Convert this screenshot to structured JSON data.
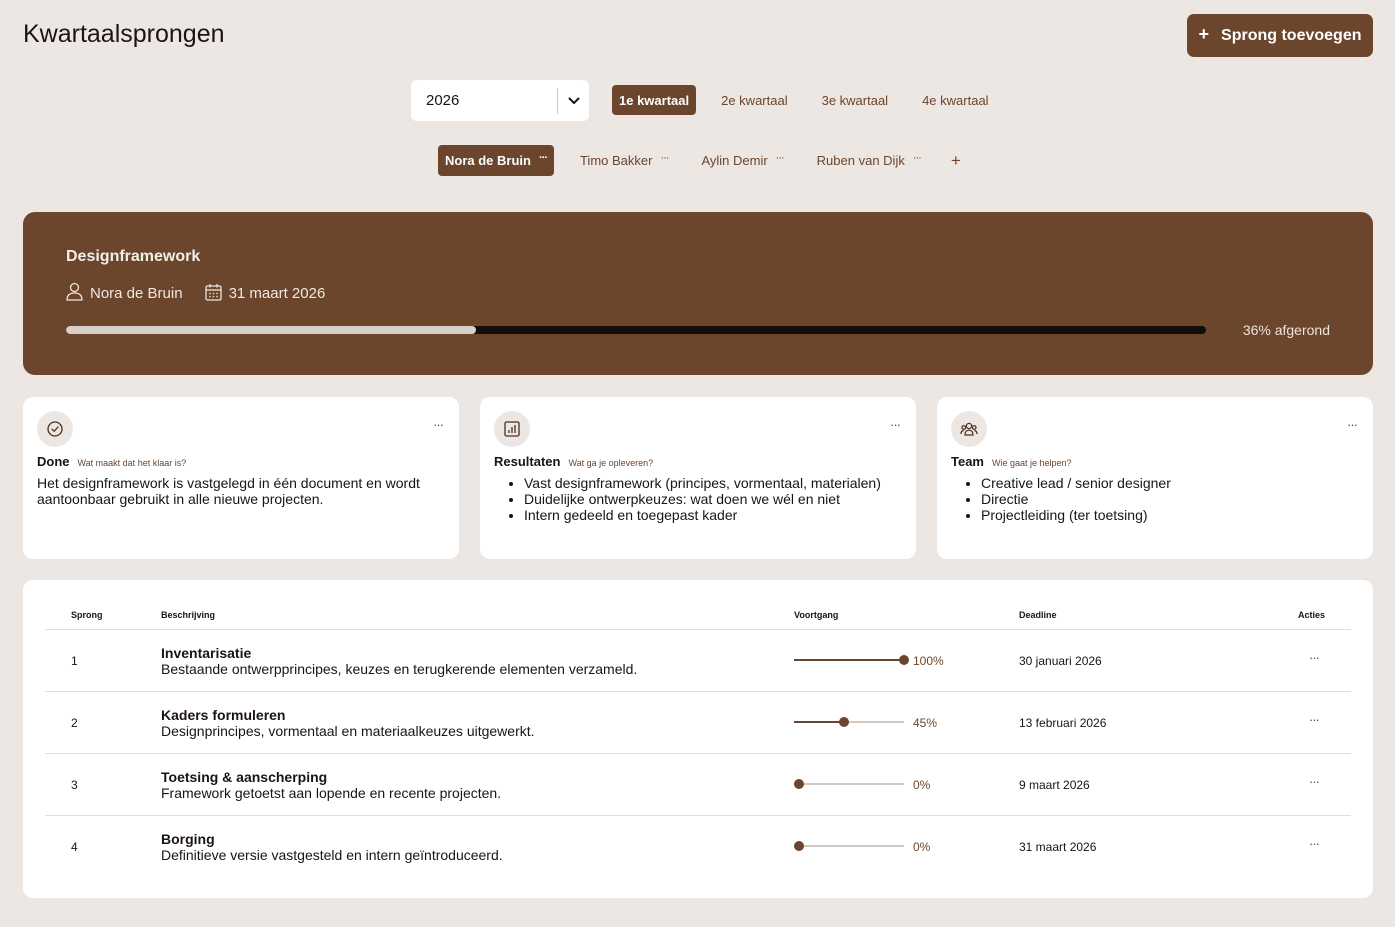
{
  "header": {
    "title": "Kwartaalsprongen",
    "add_button": "Sprong toevoegen"
  },
  "year_select": {
    "value": "2026"
  },
  "quarters": [
    {
      "label": "1e kwartaal",
      "active": true
    },
    {
      "label": "2e kwartaal",
      "active": false
    },
    {
      "label": "3e kwartaal",
      "active": false
    },
    {
      "label": "4e kwartaal",
      "active": false
    }
  ],
  "people": [
    {
      "name": "Nora de Bruin",
      "active": true
    },
    {
      "name": "Timo Bakker",
      "active": false
    },
    {
      "name": "Aylin Demir",
      "active": false
    },
    {
      "name": "Ruben van Dijk",
      "active": false
    }
  ],
  "hero": {
    "title": "Designframework",
    "owner": "Nora de Bruin",
    "date": "31 maart 2026",
    "progress_value": 0.36,
    "progress_label": "36% afgerond"
  },
  "cards": {
    "done": {
      "title": "Done",
      "subtitle": "Wat maakt dat het klaar is?",
      "text": "Het designframework is vastgelegd in één document en wordt aantoonbaar gebruikt in alle nieuwe projecten."
    },
    "results": {
      "title": "Resultaten",
      "subtitle": "Wat ga je opleveren?",
      "items": [
        "Vast designframework (principes, vormentaal, materialen)",
        "Duidelijke ontwerpkeuzes: wat doen we wél en niet",
        "Intern gedeeld en toegepast kader"
      ]
    },
    "team": {
      "title": "Team",
      "subtitle": "Wie gaat je helpen?",
      "items": [
        "Creative lead / senior designer",
        "Directie",
        "Projectleiding (ter toetsing)"
      ]
    }
  },
  "table": {
    "headers": {
      "sprong": "Sprong",
      "beschrijving": "Beschrijving",
      "voortgang": "Voortgang",
      "deadline": "Deadline",
      "acties": "Acties"
    },
    "rows": [
      {
        "num": "1",
        "title": "Inventarisatie",
        "desc": "Bestaande ontwerpprincipes, keuzes en terugkerende elementen verzameld.",
        "progress": 1.0,
        "pct": "100%",
        "deadline": "30 januari 2026"
      },
      {
        "num": "2",
        "title": "Kaders formuleren",
        "desc": "Designprincipes, vormentaal en materiaalkeuzes uitgewerkt.",
        "progress": 0.45,
        "pct": "45%",
        "deadline": "13 februari 2026"
      },
      {
        "num": "3",
        "title": "Toetsing & aanscherping",
        "desc": "Framework getoetst aan lopende en recente projecten.",
        "progress": 0.0,
        "pct": "0%",
        "deadline": "9 maart 2026"
      },
      {
        "num": "4",
        "title": "Borging",
        "desc": "Definitieve versie vastgesteld en intern geïntroduceerd.",
        "progress": 0.0,
        "pct": "0%",
        "deadline": "31 maart 2026"
      }
    ]
  },
  "colors": {
    "brand": "#6b452c",
    "background": "#ede7e3",
    "surface": "#ffffff"
  }
}
